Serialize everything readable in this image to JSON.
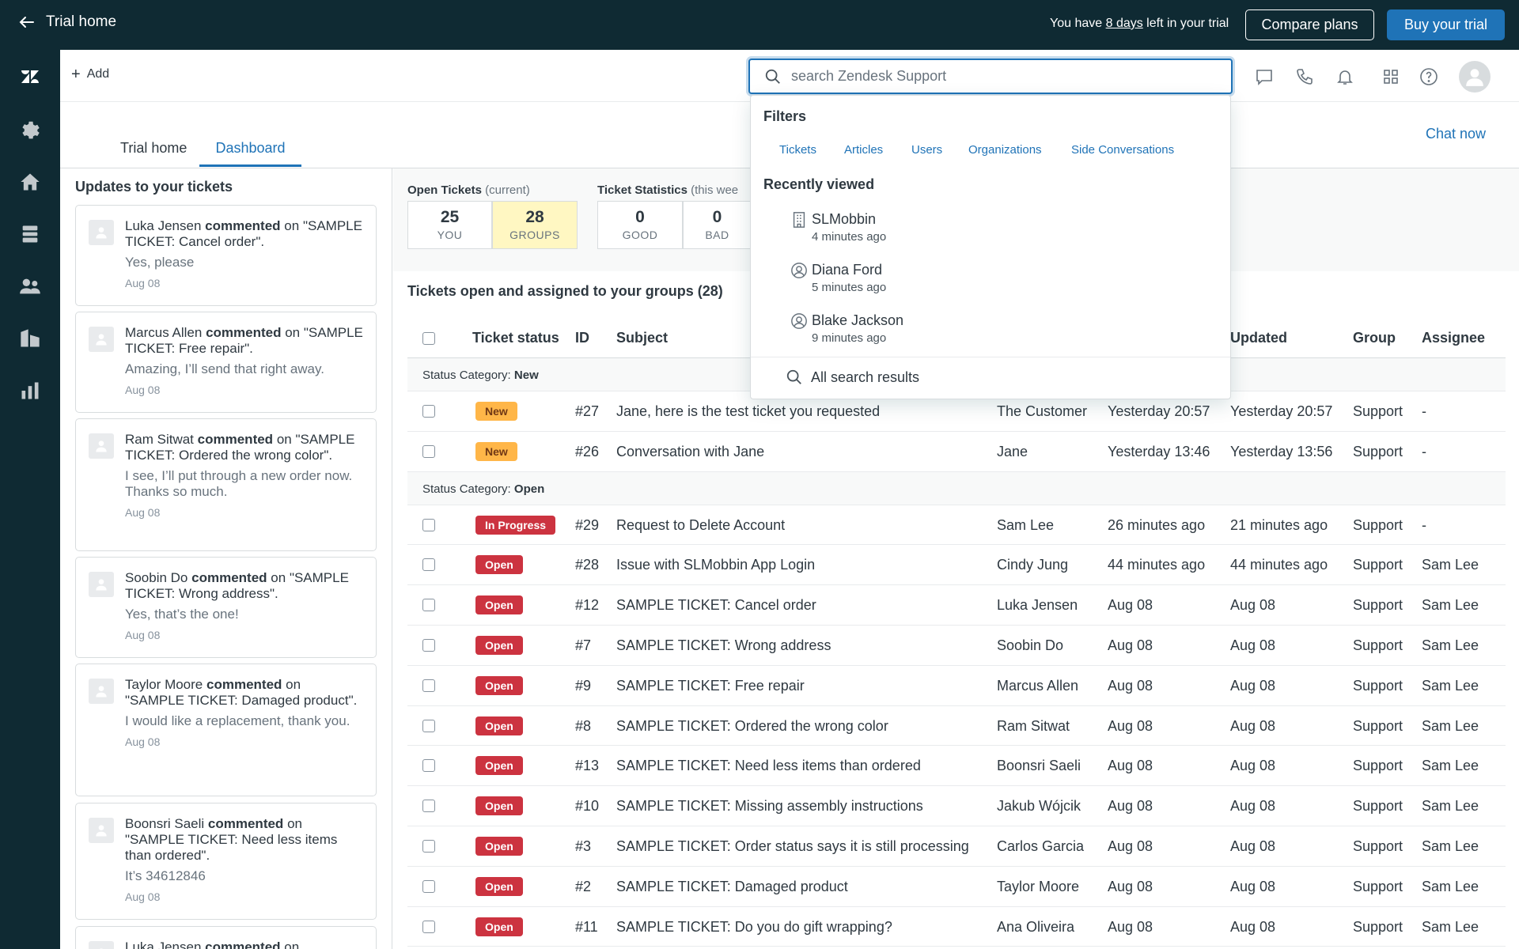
{
  "banner": {
    "back_label": "Trial home",
    "trial_prefix": "You have ",
    "trial_days": "8 days",
    "trial_suffix": " left in your trial",
    "compare_label": "Compare plans",
    "buy_label": "Buy your trial",
    "bg_color": "#0f2a33",
    "buy_color": "#1f73b7"
  },
  "nav": {
    "icons": [
      "zendesk-logo-icon",
      "gear-icon",
      "home-icon",
      "views-icon",
      "users-icon",
      "organizations-icon",
      "reporting-icon"
    ]
  },
  "topbar": {
    "add_label": "Add",
    "search_placeholder": "search Zendesk Support",
    "icons": [
      "conversations-icon",
      "phone-icon",
      "bell-icon",
      "apps-grid-icon",
      "help-icon",
      "user-avatar-icon"
    ]
  },
  "tabs": [
    {
      "label": "Trial home",
      "active": false
    },
    {
      "label": "Dashboard",
      "active": true
    }
  ],
  "chat_now": "Chat now",
  "updates": {
    "title": "Updates to your tickets",
    "items": [
      {
        "name": "Luka Jensen",
        "verb": "commented",
        "on": "on",
        "ticket": "\"SAMPLE TICKET: Cancel order\".",
        "quote": "Yes, please",
        "date": "Aug 08"
      },
      {
        "name": "Marcus Allen",
        "verb": "commented",
        "on": "on",
        "ticket": "\"SAMPLE TICKET: Free repair\".",
        "quote": "Amazing, I’ll send that right away.",
        "date": "Aug 08"
      },
      {
        "name": "Ram Sitwat",
        "verb": "commented",
        "on": "on",
        "ticket": "\"SAMPLE TICKET: Ordered the wrong color\".",
        "quote": "I see, I’ll put through a new order now. Thanks so much.",
        "date": "Aug 08"
      },
      {
        "name": "Soobin Do",
        "verb": "commented",
        "on": "on",
        "ticket": "\"SAMPLE TICKET: Wrong address\".",
        "quote": "Yes, that’s the one!",
        "date": "Aug 08"
      },
      {
        "name": "Taylor Moore",
        "verb": "commented",
        "on": "on",
        "ticket": "\"SAMPLE TICKET: Damaged product\".",
        "quote": "I would like a replacement, thank you.",
        "date": "Aug 08"
      },
      {
        "name": "Boonsri Saeli",
        "verb": "commented",
        "on": "on",
        "ticket": "\"SAMPLE TICKET: Need less items than ordered\".",
        "quote": "It’s 34612846",
        "date": "Aug 08"
      },
      {
        "name": "Luka Jensen",
        "verb": "commented",
        "on": "on",
        "ticket": "",
        "quote": "",
        "date": ""
      }
    ]
  },
  "stats": {
    "open_title": "Open Tickets",
    "open_sub": "(current)",
    "open": [
      {
        "num": "25",
        "label": "YOU"
      },
      {
        "num": "28",
        "label": "GROUPS"
      }
    ],
    "stat_title": "Ticket Statistics",
    "stat_sub": "(this wee",
    "statistics": [
      {
        "num": "0",
        "label": "GOOD"
      },
      {
        "num": "0",
        "label": "BAD"
      }
    ]
  },
  "view": {
    "title": "Tickets open and assigned to your groups (28)",
    "columns": {
      "status": "Ticket status",
      "id": "ID",
      "subject": "Subject",
      "updated": "Updated",
      "group": "Group",
      "assignee": "Assignee"
    },
    "cat_prefix": "Status Category: ",
    "cat_new": "New",
    "cat_open": "Open",
    "new_rows": [
      {
        "status": "New",
        "id": "#27",
        "subject": "Jane, here is the test ticket you requested",
        "requester": "The Customer",
        "requested": "Yesterday 20:57",
        "updated": "Yesterday 20:57",
        "group": "Support",
        "assignee": "-"
      },
      {
        "status": "New",
        "id": "#26",
        "subject": "Conversation with Jane",
        "requester": "Jane",
        "requested": "Yesterday 13:46",
        "updated": "Yesterday 13:56",
        "group": "Support",
        "assignee": "-"
      }
    ],
    "open_rows": [
      {
        "status": "In Progress",
        "id": "#29",
        "subject": "Request to Delete Account",
        "requester": "Sam Lee",
        "requested": "26 minutes ago",
        "updated": "21 minutes ago",
        "group": "Support",
        "assignee": "-"
      },
      {
        "status": "Open",
        "id": "#28",
        "subject": "Issue with SLMobbin App Login",
        "requester": "Cindy Jung",
        "requested": "44 minutes ago",
        "updated": "44 minutes ago",
        "group": "Support",
        "assignee": "Sam Lee"
      },
      {
        "status": "Open",
        "id": "#12",
        "subject": "SAMPLE TICKET: Cancel order",
        "requester": "Luka Jensen",
        "requested": "Aug 08",
        "updated": "Aug 08",
        "group": "Support",
        "assignee": "Sam Lee"
      },
      {
        "status": "Open",
        "id": "#7",
        "subject": "SAMPLE TICKET: Wrong address",
        "requester": "Soobin Do",
        "requested": "Aug 08",
        "updated": "Aug 08",
        "group": "Support",
        "assignee": "Sam Lee"
      },
      {
        "status": "Open",
        "id": "#9",
        "subject": "SAMPLE TICKET: Free repair",
        "requester": "Marcus Allen",
        "requested": "Aug 08",
        "updated": "Aug 08",
        "group": "Support",
        "assignee": "Sam Lee"
      },
      {
        "status": "Open",
        "id": "#8",
        "subject": "SAMPLE TICKET: Ordered the wrong color",
        "requester": "Ram Sitwat",
        "requested": "Aug 08",
        "updated": "Aug 08",
        "group": "Support",
        "assignee": "Sam Lee"
      },
      {
        "status": "Open",
        "id": "#13",
        "subject": "SAMPLE TICKET: Need less items than ordered",
        "requester": "Boonsri Saeli",
        "requested": "Aug 08",
        "updated": "Aug 08",
        "group": "Support",
        "assignee": "Sam Lee"
      },
      {
        "status": "Open",
        "id": "#10",
        "subject": "SAMPLE TICKET: Missing assembly instructions",
        "requester": "Jakub Wójcik",
        "requested": "Aug 08",
        "updated": "Aug 08",
        "group": "Support",
        "assignee": "Sam Lee"
      },
      {
        "status": "Open",
        "id": "#3",
        "subject": "SAMPLE TICKET: Order status says it is still processing",
        "requester": "Carlos Garcia",
        "requested": "Aug 08",
        "updated": "Aug 08",
        "group": "Support",
        "assignee": "Sam Lee"
      },
      {
        "status": "Open",
        "id": "#2",
        "subject": "SAMPLE TICKET: Damaged product",
        "requester": "Taylor Moore",
        "requested": "Aug 08",
        "updated": "Aug 08",
        "group": "Support",
        "assignee": "Sam Lee"
      },
      {
        "status": "Open",
        "id": "#11",
        "subject": "SAMPLE TICKET: Do you do gift wrapping?",
        "requester": "Ana Oliveira",
        "requested": "Aug 08",
        "updated": "Aug 08",
        "group": "Support",
        "assignee": "Sam Lee"
      }
    ]
  },
  "dropdown": {
    "filters_title": "Filters",
    "filters": [
      "Tickets",
      "Articles",
      "Users",
      "Organizations",
      "Side Conversations"
    ],
    "recent_title": "Recently viewed",
    "recent": [
      {
        "icon": "building-icon",
        "name": "SLMobbin",
        "time": "4 minutes ago"
      },
      {
        "icon": "user-circle-icon",
        "name": "Diana Ford",
        "time": "5 minutes ago"
      },
      {
        "icon": "user-circle-icon",
        "name": "Blake Jackson",
        "time": "9 minutes ago"
      }
    ],
    "all_results": "All search results"
  }
}
